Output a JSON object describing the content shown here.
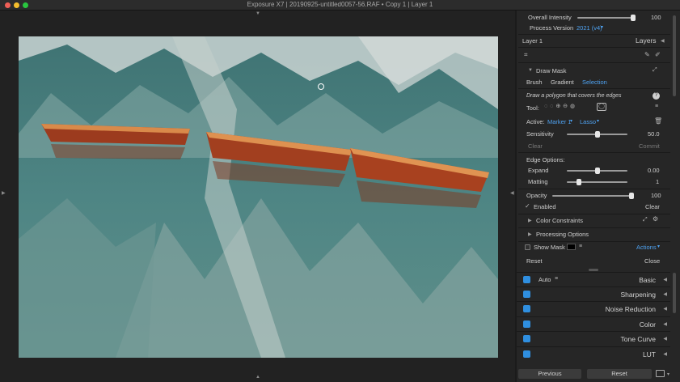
{
  "window": {
    "title": "Exposure X7 | 20190925-untitled0057-56.RAF • Copy 1 | Layer 1"
  },
  "colors": {
    "accent": "#4fa3f2",
    "panel_bg": "#262626",
    "canvas_bg": "#222222",
    "toggle_blue": "#2f8fe0"
  },
  "panel": {
    "overall_intensity": {
      "label": "Overall Intensity",
      "value": "100",
      "level": 1.0
    },
    "process_version": {
      "label": "Process Version",
      "value": "2021 (v4)"
    },
    "layer_name": "Layer 1",
    "layers_label": "Layers",
    "draw_mask": {
      "title": "Draw Mask",
      "tabs": [
        "Brush",
        "Gradient",
        "Selection"
      ],
      "active_tab": "Selection",
      "hint": "Draw a polygon that covers the edges",
      "tool_label": "Tool:",
      "active_label": "Active:",
      "active_marker": "Marker 1",
      "active_mode": "Lasso",
      "sensitivity": {
        "label": "Sensitivity",
        "value": "50.0",
        "level": 0.5
      },
      "clear_label": "Clear",
      "commit_label": "Commit",
      "edge_options_label": "Edge Options:",
      "expand": {
        "label": "Expand",
        "value": "0.00",
        "level": 0.5
      },
      "matting": {
        "label": "Matting",
        "value": "1",
        "level": 0.2
      },
      "opacity": {
        "label": "Opacity",
        "value": "100",
        "level": 1.0
      },
      "enabled_label": "Enabled",
      "enabled_clear": "Clear",
      "color_constraints": "Color Constraints",
      "processing_options": "Processing Options",
      "show_mask": "Show Mask",
      "actions": "Actions",
      "reset": "Reset",
      "close": "Close"
    },
    "sections": [
      {
        "name": "Basic",
        "extra": "Auto"
      },
      {
        "name": "Sharpening"
      },
      {
        "name": "Noise Reduction"
      },
      {
        "name": "Color"
      },
      {
        "name": "Tone Curve"
      },
      {
        "name": "LUT"
      }
    ],
    "footer": {
      "previous": "Previous",
      "reset": "Reset"
    }
  }
}
